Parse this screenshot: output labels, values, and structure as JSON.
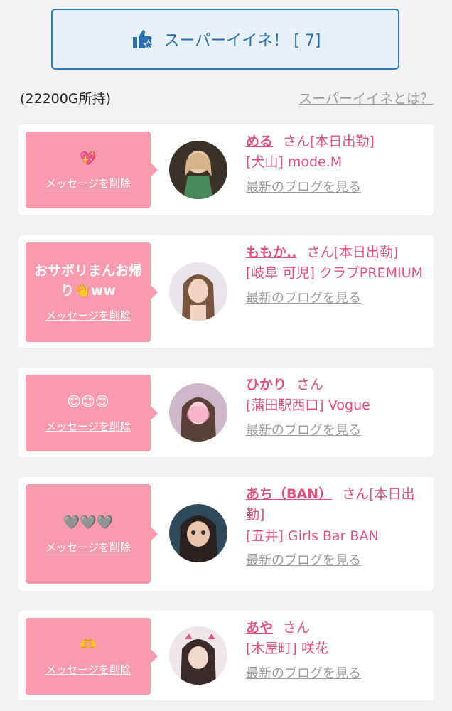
{
  "super_button": {
    "label": "スーパーイイネ！ [ 7]"
  },
  "points": {
    "owned": "(22200G所持)"
  },
  "what_link": "スーパーイイネとは？",
  "delete_label": "メッセージを削除",
  "blog_label": "最新のブログを見る",
  "colors": {
    "accent_pink": "#e0507a",
    "bubble_pink": "#f99aae",
    "button_blue": "#2e7fb8"
  },
  "cards": [
    {
      "message": "💖",
      "name": "める",
      "suffix": "さん[本日出勤]",
      "shop": "[犬山] mode.M"
    },
    {
      "message": "おサボリまんお帰り👋ww",
      "name": "ももか..",
      "suffix": "さん[本日出勤]",
      "shop": "[岐阜 可児] クラブPREMIUM"
    },
    {
      "message": "😊😊😊",
      "name": "ひかり",
      "suffix": "さん",
      "shop": "[蒲田駅西口] Vogue"
    },
    {
      "message": "🩶🩶🩶",
      "name": "あち（BAN）",
      "suffix": "さん[本日出勤]",
      "shop": "[五井] Girls Bar BAN"
    },
    {
      "message": "🫶",
      "name": "あや",
      "suffix": "さん",
      "shop": "[木屋町] 咲花"
    }
  ]
}
